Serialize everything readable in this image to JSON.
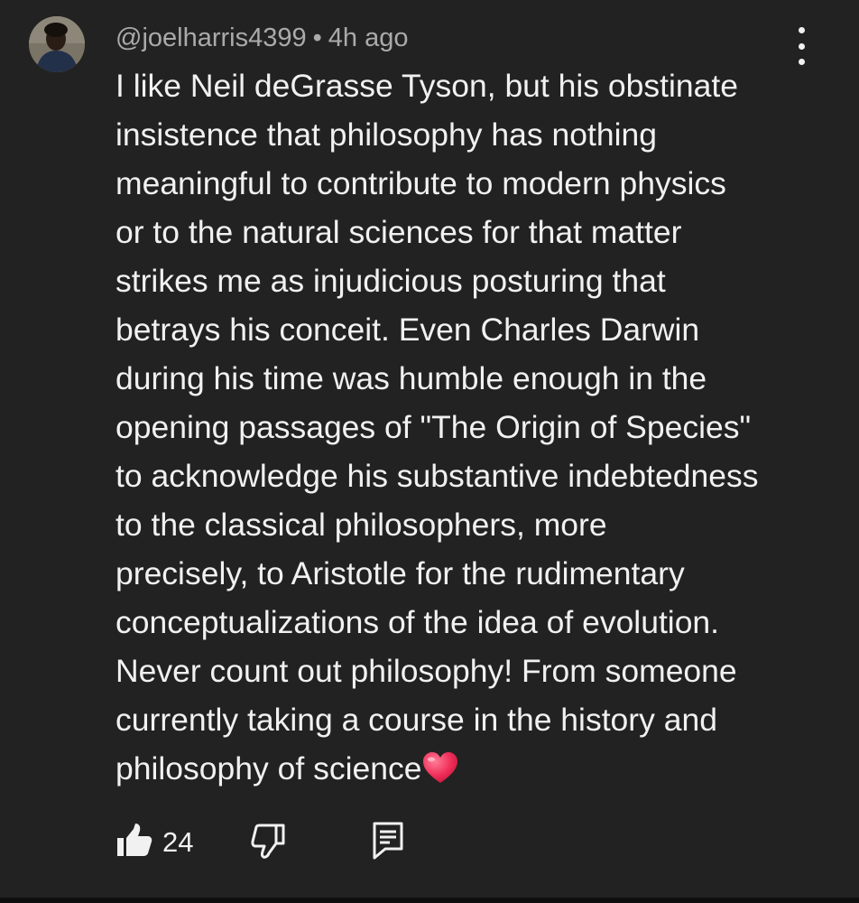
{
  "comment": {
    "author": "@joelharris4399",
    "separator": "•",
    "time": "4h ago",
    "text": "I like Neil deGrasse Tyson, but his obstinate\ninsistence that philosophy has nothing\nmeaningful to contribute to modern physics\nor to the natural sciences for that matter\nstrikes me as injudicious posturing that\nbetrays his conceit. Even Charles Darwin\nduring his time was humble enough in the\nopening passages of \"The Origin of Species\"\nto acknowledge his substantive indebtedness\nto the classical philosophers, more\nprecisely, to Aristotle for the rudimentary\nconceptualizations of the idea of evolution.\nNever count out philosophy! From someone\ncurrently taking a course in the history and\nphilosophy of science",
    "emoji": "heart-emoji",
    "like_count": "24"
  },
  "icons": {
    "more": "more-vert-icon",
    "like": "thumbs-up-icon",
    "dislike": "thumbs-down-icon",
    "reply": "reply-icon"
  },
  "colors": {
    "background": "#222222",
    "text": "#f1f1f1",
    "meta": "#aaaaaa",
    "heart": "#f0305a"
  }
}
